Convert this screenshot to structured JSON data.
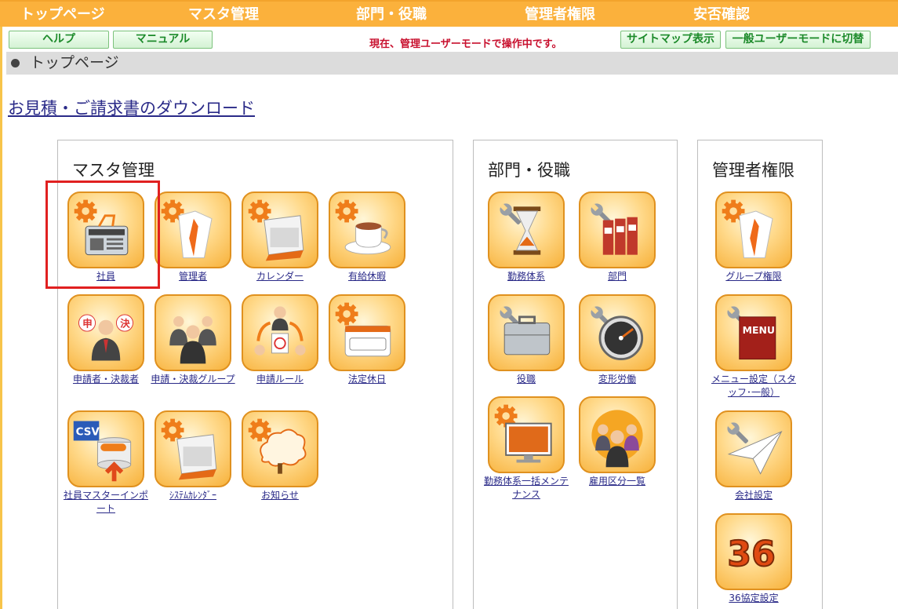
{
  "topnav": {
    "items": [
      "トップページ",
      "マスタ管理",
      "部門・役職",
      "管理者権限",
      "安否確認"
    ]
  },
  "toolbar": {
    "help_label": "ヘルプ",
    "manual_label": "マニュアル",
    "mode_message": "現在、管理ユーザーモードで操作中です。",
    "sitemap_label": "サイトマップ表示",
    "switch_label": "一般ユーザーモードに切替"
  },
  "breadcrumb": {
    "current": "トップページ"
  },
  "download_link": "お見積・ご請求書のダウンロード",
  "panels": {
    "master": {
      "title": "マスタ管理",
      "tiles": [
        {
          "label": "社員",
          "icon": "id-card-icon"
        },
        {
          "label": "管理者",
          "icon": "shirt-tie-icon"
        },
        {
          "label": "カレンダー",
          "icon": "calendar-icon"
        },
        {
          "label": "有給休暇",
          "icon": "coffee-cup-icon"
        },
        {
          "label": "申請者・決裁者",
          "icon": "applicant-approver-icon"
        },
        {
          "label": "申請・決裁グループ",
          "icon": "group-people-icon"
        },
        {
          "label": "申請ルール",
          "icon": "application-rule-icon"
        },
        {
          "label": "法定休日",
          "icon": "legal-holiday-calendar-icon"
        },
        {
          "label": "社員マスターインポート",
          "icon": "csv-import-icon"
        },
        {
          "label": "ｼｽﾃﾑｶﾚﾝﾀﾞｰ",
          "icon": "system-calendar-icon"
        },
        {
          "label": "お知らせ",
          "icon": "notice-cloud-icon"
        }
      ]
    },
    "department": {
      "title": "部門・役職",
      "tiles": [
        {
          "label": "勤務体系",
          "icon": "hourglass-icon"
        },
        {
          "label": "部門",
          "icon": "binders-icon"
        },
        {
          "label": "役職",
          "icon": "briefcase-icon"
        },
        {
          "label": "変形労働",
          "icon": "speedometer-icon"
        },
        {
          "label": "勤務体系一括メンテナンス",
          "icon": "monitor-icon"
        },
        {
          "label": "雇用区分一覧",
          "icon": "workers-group-icon"
        }
      ]
    },
    "admin": {
      "title": "管理者権限",
      "tiles": [
        {
          "label": "グループ権限",
          "icon": "shirt-tie-icon"
        },
        {
          "label": "メニュー設定（スタッフ･一般）",
          "icon": "menu-book-icon"
        },
        {
          "label": "会社設定",
          "icon": "paper-plane-icon"
        },
        {
          "label": "36協定設定",
          "icon": "number-36-icon"
        }
      ]
    }
  },
  "colors": {
    "nav_bg": "#fbb13c",
    "mode_message": "#c8102e",
    "link": "#2a2a88",
    "highlight": "#e02020"
  }
}
